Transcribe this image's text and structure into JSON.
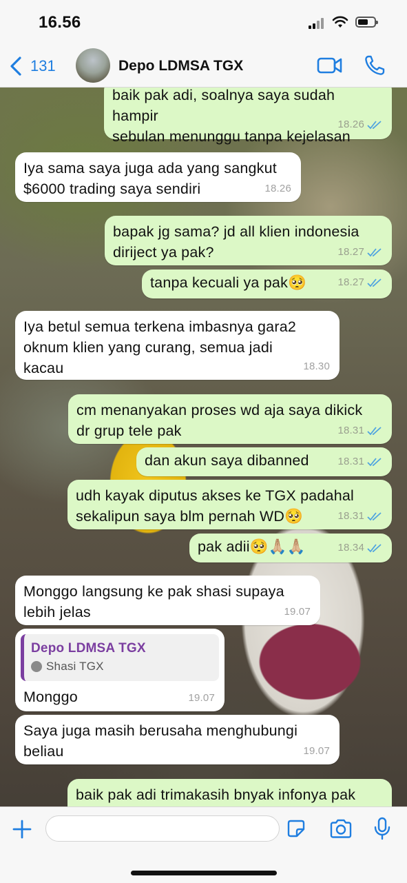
{
  "status_bar": {
    "time": "16.56"
  },
  "header": {
    "back_count": "131",
    "title": "Depo LDMSA TGX"
  },
  "colors": {
    "accent": "#1f7ee0",
    "outgoing_bubble": "#dcf8c6",
    "incoming_bubble": "#ffffff",
    "quote_accent": "#7b3ea0",
    "read_ticks": "#4fa3e0"
  },
  "icons": [
    "chevron-left-icon",
    "video-icon",
    "phone-icon",
    "plus-icon",
    "sticker-icon",
    "camera-icon",
    "microphone-icon",
    "read-ticks-icon"
  ],
  "messages": [
    {
      "dir": "out",
      "text": "baik pak adi, soalnya saya sudah hampir\nsebulan menunggu tanpa kejelasan",
      "time": "18.26",
      "read": true
    },
    {
      "dir": "in",
      "text": "Iya sama saya juga ada yang sangkut\n$6000 trading saya sendiri",
      "time": "18.26"
    },
    {
      "dir": "out",
      "text": "bapak jg sama? jd all klien indonesia\ndiriject ya pak?",
      "time": "18.27",
      "read": true
    },
    {
      "dir": "out",
      "text": "tanpa kecuali ya pak🥺",
      "time": "18.27",
      "read": true
    },
    {
      "dir": "in",
      "text": "Iya betul semua terkena imbasnya gara2\noknum klien yang curang, semua jadi\nkacau",
      "time": "18.30"
    },
    {
      "dir": "out",
      "text": "cm menanyakan proses wd aja saya dikick\ndr grup tele pak",
      "time": "18.31",
      "read": true
    },
    {
      "dir": "out",
      "text": "dan akun saya dibanned",
      "time": "18.31",
      "read": true
    },
    {
      "dir": "out",
      "text": "udh kayak diputus akses ke TGX padahal\nsekalipun saya blm pernah WD🥺",
      "time": "18.31",
      "read": true
    },
    {
      "dir": "out",
      "text": "pak adii🥺🙏🏼🙏🏼",
      "time": "18.34",
      "read": true
    },
    {
      "dir": "in",
      "text": "Monggo langsung ke pak shasi supaya\nlebih jelas",
      "time": "19.07"
    },
    {
      "dir": "in",
      "quote_title": "Depo LDMSA TGX",
      "quote_author": "Shasi TGX",
      "text": "Monggo",
      "time": "19.07"
    },
    {
      "dir": "in",
      "text": "Saya juga masih berusaha menghubungi\nbeliau",
      "time": "19.07"
    },
    {
      "dir": "out",
      "text": "baik pak adi trimakasih bnyak infonya pak",
      "time": "",
      "read": false
    }
  ],
  "composer": {
    "placeholder": ""
  }
}
